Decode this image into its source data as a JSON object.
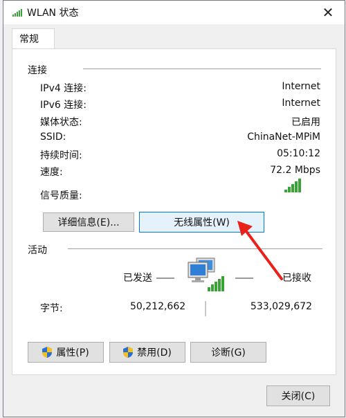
{
  "window": {
    "title": "WLAN 状态",
    "close_glyph": "✕"
  },
  "tabs": [
    {
      "label": "常规"
    }
  ],
  "connection": {
    "title": "连接",
    "rows": [
      {
        "label": "IPv4 连接:",
        "value": "Internet"
      },
      {
        "label": "IPv6 连接:",
        "value": "Internet"
      },
      {
        "label": "媒体状态:",
        "value": "已启用"
      },
      {
        "label": "SSID:",
        "value": "ChinaNet-MPiM"
      },
      {
        "label": "持续时间:",
        "value": "05:10:12"
      },
      {
        "label": "速度:",
        "value": "72.2 Mbps"
      }
    ],
    "signal_label": "信号质量:",
    "signal_bars": 5,
    "signal_bars_filled": 5,
    "details_button": "详细信息(E)...",
    "wireless_button": "无线属性(W)"
  },
  "activity": {
    "title": "活动",
    "sent_label": "已发送",
    "received_label": "已接收",
    "bytes_label": "字节:",
    "bytes_sent": "50,212,662",
    "bytes_received": "533,029,672",
    "icon": "network-computers-icon"
  },
  "buttons": {
    "properties": "属性(P)",
    "disable": "禁用(D)",
    "diagnose": "诊断(G)",
    "close": "关闭(C)"
  },
  "colors": {
    "signal_green": "#3aa335",
    "accent_blue": "#0078d7",
    "arrow_red": "#e8221b"
  }
}
